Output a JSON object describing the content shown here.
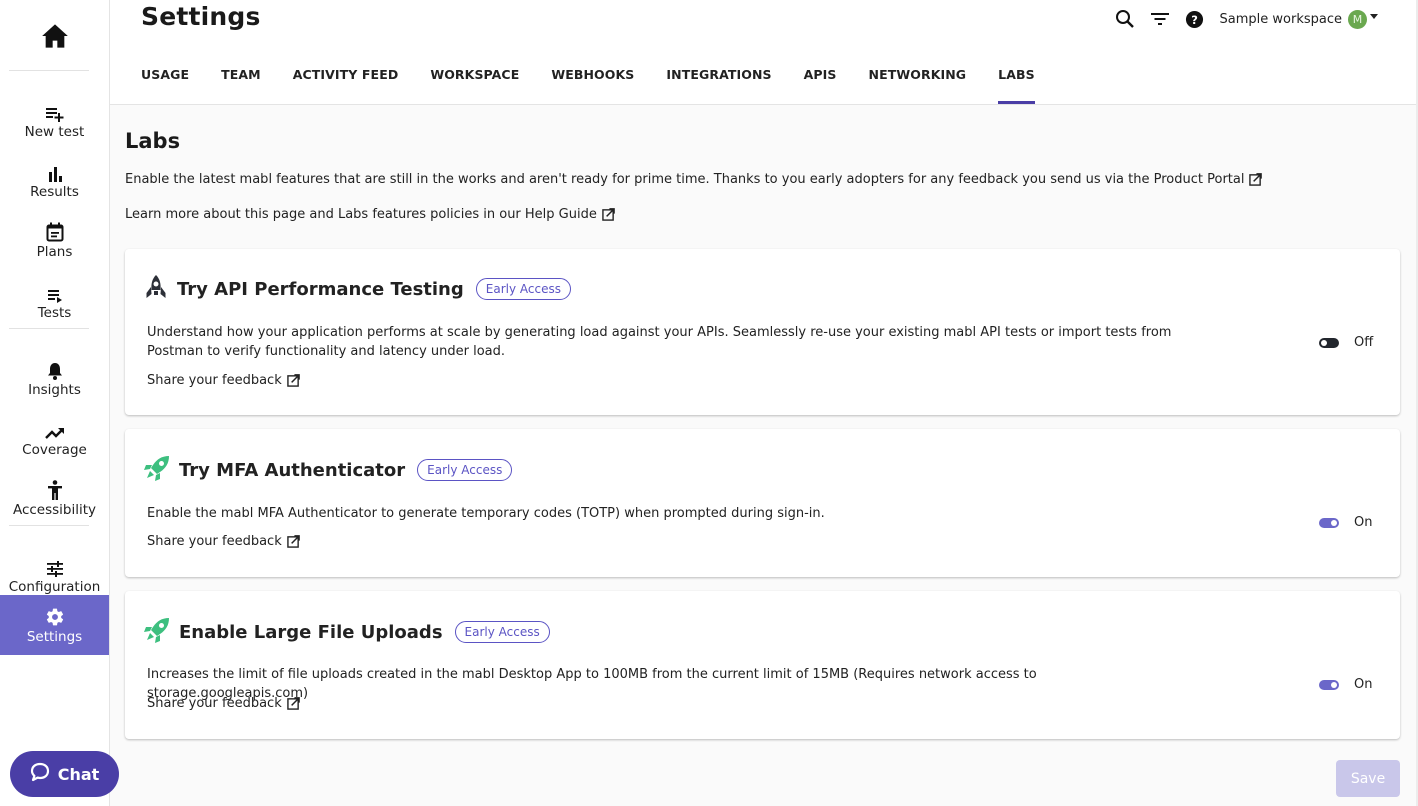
{
  "sidebar": {
    "home_icon": "home-icon",
    "items": [
      {
        "label": "New test",
        "icon": "playlist-add-icon"
      },
      {
        "label": "Results",
        "icon": "bar-chart-icon"
      },
      {
        "label": "Plans",
        "icon": "calendar-icon"
      },
      {
        "label": "Tests",
        "icon": "playlist-play-icon"
      },
      {
        "label": "Insights",
        "icon": "bell-icon"
      },
      {
        "label": "Coverage",
        "icon": "trending-up-icon"
      },
      {
        "label": "Accessibility",
        "icon": "accessibility-icon"
      },
      {
        "label": "Configuration",
        "icon": "tune-icon"
      },
      {
        "label": "Settings",
        "icon": "gear-icon",
        "active": true
      }
    ],
    "chat_label": "Chat"
  },
  "header": {
    "title": "Settings",
    "workspace_name": "Sample workspace",
    "avatar_initial": "M",
    "avatar_color": "#6aa84f",
    "icons": [
      "search-icon",
      "filter-icon",
      "help-icon"
    ],
    "tabs": [
      {
        "label": "USAGE"
      },
      {
        "label": "TEAM"
      },
      {
        "label": "ACTIVITY FEED"
      },
      {
        "label": "WORKSPACE"
      },
      {
        "label": "WEBHOOKS"
      },
      {
        "label": "INTEGRATIONS"
      },
      {
        "label": "APIS"
      },
      {
        "label": "NETWORKING"
      },
      {
        "label": "LABS",
        "active": true
      }
    ]
  },
  "labs": {
    "title": "Labs",
    "intro1": "Enable the latest mabl features that are still in the works and aren't ready for prime time. Thanks to you early adopters for any feedback you send us via the Product Portal",
    "intro2": "Learn more about this page and Labs features policies in our Help Guide",
    "features": [
      {
        "title": "Try API Performance Testing",
        "badge": "Early Access",
        "description": "Understand how your application performs at scale by generating load against your APIs. Seamlessly re-use your existing mabl API tests or import tests from Postman to verify functionality and latency under load.",
        "feedback_label": "Share your feedback",
        "enabled": false,
        "state_label": "Off",
        "icon_color": "#2d3038"
      },
      {
        "title": "Try MFA Authenticator",
        "badge": "Early Access",
        "description": "Enable the mabl MFA Authenticator to generate temporary codes (TOTP) when prompted during sign-in.",
        "feedback_label": "Share your feedback",
        "enabled": true,
        "state_label": "On",
        "icon_color": "#3dbf7f"
      },
      {
        "title": "Enable Large File Uploads",
        "badge": "Early Access",
        "description": "Increases the limit of file uploads created in the mabl Desktop App to 100MB from the current limit of 15MB (Requires network access to storage.googleapis.com)",
        "feedback_label": "Share your feedback",
        "enabled": true,
        "state_label": "On",
        "icon_color": "#3dbf7f"
      }
    ],
    "save_label": "Save"
  },
  "colors": {
    "accent": "#4a3ea6",
    "sidebar_active": "#6b67c9",
    "toggle_on": "#6b67c9",
    "toggle_off": "#22262d",
    "save_disabled": "#c9c7ea"
  }
}
